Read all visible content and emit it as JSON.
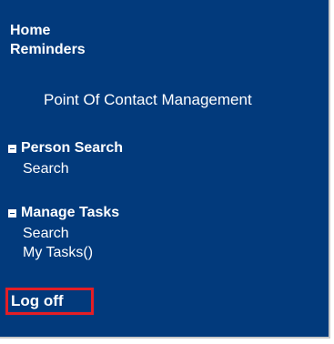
{
  "nav": {
    "home": "Home",
    "reminders": "Reminders",
    "point_of_contact": "Point Of Contact Management",
    "sections": {
      "person_search": {
        "title": "Person Search",
        "items": [
          "Search"
        ]
      },
      "manage_tasks": {
        "title": "Manage Tasks",
        "items": [
          "Search",
          "My Tasks()"
        ]
      }
    },
    "logoff": "Log off"
  },
  "colors": {
    "background": "#023a7c",
    "text": "#ffffff",
    "highlight_border": "#e41e25"
  }
}
